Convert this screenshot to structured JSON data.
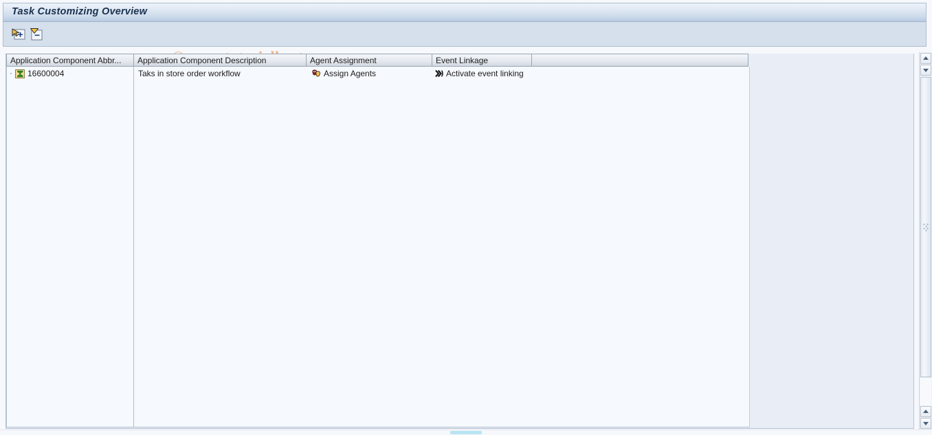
{
  "window": {
    "title": "Task Customizing Overview"
  },
  "watermark": {
    "text": "© www.tutorialkart.com",
    "color": "#efb387"
  },
  "toolbar": {
    "buttons": [
      {
        "name": "expand-all",
        "tooltip": "Expand All",
        "icon": "expand-all-icon"
      },
      {
        "name": "collapse-all",
        "tooltip": "Collapse All",
        "icon": "collapse-all-icon"
      }
    ]
  },
  "grid": {
    "columns": [
      {
        "key": "component_abbr",
        "label": "Application Component Abbr..."
      },
      {
        "key": "component_desc",
        "label": "Application Component Description"
      },
      {
        "key": "agent_assignment",
        "label": "Agent Assignment"
      },
      {
        "key": "event_linkage",
        "label": "Event Linkage"
      },
      {
        "key": "filler",
        "label": ""
      }
    ],
    "rows": [
      {
        "tree_marker": "·",
        "component_icon": "workflow-task-sigma-icon",
        "component_abbr": "16600004",
        "component_desc": "Taks in store order workflow",
        "agent_icon": "assign-agents-icon",
        "agent_assignment": "Assign Agents",
        "event_icon": "event-linkage-icon",
        "event_linkage": "Activate event linking"
      }
    ]
  },
  "scrollbars": {
    "vertical": {
      "up_label": "▲",
      "down_label": "▼"
    }
  },
  "colors": {
    "title_bar_top": "#eef3fa",
    "title_bar_bottom": "#b8cbe2",
    "toolbar_bg": "#d5e0ec",
    "grid_bg": "#f6f9fd",
    "panel_bg": "#e9eef6",
    "header_border": "#9aa5b3",
    "title_text": "#19324e",
    "hscroll_indicator": "#b9e4f4"
  }
}
